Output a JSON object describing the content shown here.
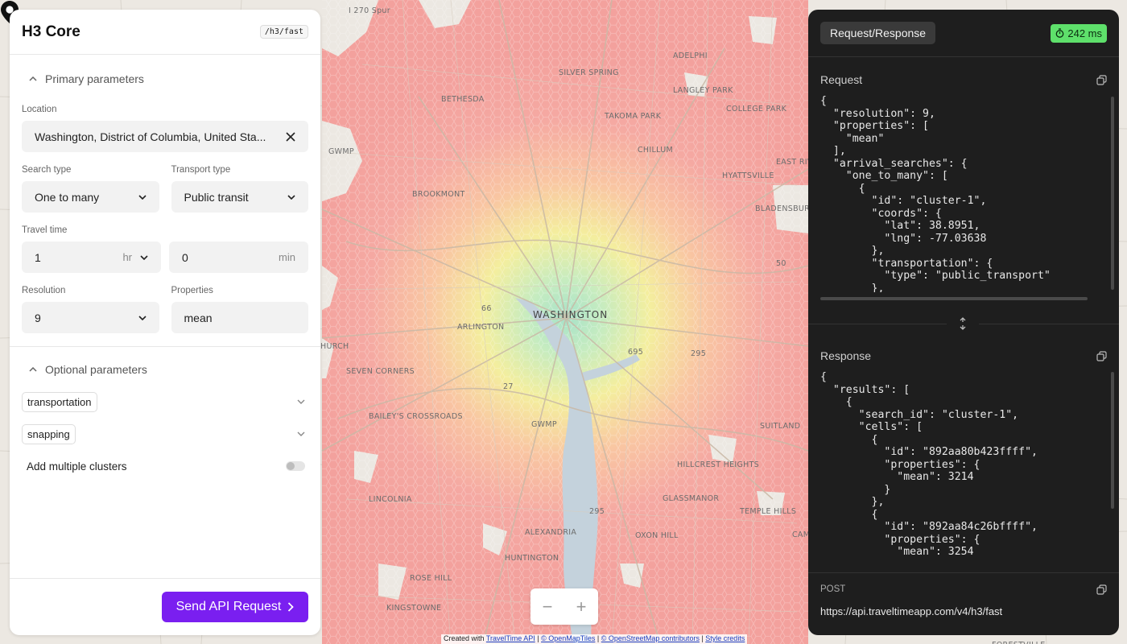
{
  "app": {
    "title": "H3 Core",
    "endpoint_badge": "/h3/fast"
  },
  "primary": {
    "section_label": "Primary parameters",
    "location": {
      "label": "Location",
      "value": "Washington, District of Columbia, United Sta..."
    },
    "search_type": {
      "label": "Search type",
      "value": "One to many"
    },
    "transport_type": {
      "label": "Transport type",
      "value": "Public transit"
    },
    "travel_time": {
      "label": "Travel time",
      "hours": "1",
      "hours_unit": "hr",
      "minutes": "0",
      "minutes_unit": "min"
    },
    "resolution": {
      "label": "Resolution",
      "value": "9"
    },
    "properties": {
      "label": "Properties",
      "value": "mean"
    }
  },
  "optional": {
    "section_label": "Optional parameters",
    "items": [
      "transportation",
      "snapping"
    ],
    "clusters_label": "Add multiple clusters",
    "clusters_enabled": false
  },
  "send_button": "Send API Request",
  "map": {
    "labels": [
      "I 270 Spur",
      "SILVER SPRING",
      "ADELPHI",
      "LANGLEY PARK",
      "BETHESDA",
      "TAKOMA PARK",
      "COLLEGE PARK",
      "CHILLUM",
      "GWMP",
      "EAST RIV",
      "HYATTSVILLE",
      "BROOKMONT",
      "BLADENSBURG",
      "WASHINGTON",
      "ARLINGTON",
      "HURCH",
      "SEVEN CORNERS",
      "BAILEY'S CROSSROADS",
      "SUITLAND",
      "GWMP",
      "HILLCREST HEIGHTS",
      "LINCOLNIA",
      "GLASSMANOR",
      "TEMPLE HILLS",
      "ALEXANDRIA",
      "OXON HILL",
      "CAMP",
      "HUNTINGTON",
      "ROSE HILL",
      "KINGSTOWNE",
      "FORESTVILLE",
      "66",
      "695",
      "295",
      "27",
      "50",
      "295"
    ],
    "zoom_out": "−",
    "zoom_in": "+",
    "attribution": {
      "prefix": "Created with",
      "link1": "TravelTime API",
      "link2": "© OpenMapTiles",
      "link3": "© OpenStreetMap contributors",
      "link4": "Style credits"
    }
  },
  "api_panel": {
    "tab": "Request/Response",
    "timing": "242 ms",
    "request_label": "Request",
    "response_label": "Response",
    "method": "POST",
    "url": "https://api.traveltimeapp.com/v4/h3/fast",
    "request_lines": [
      "{",
      "  \"resolution\": 9,",
      "  \"properties\": [",
      "    \"mean\"",
      "  ],",
      "  \"arrival_searches\": {",
      "    \"one_to_many\": [",
      "      {",
      "        \"id\": \"cluster-1\",",
      "        \"coords\": {",
      "          \"lat\": 38.8951,",
      "          \"lng\": -77.03638",
      "        },",
      "        \"transportation\": {",
      "          \"type\": \"public_transport\"",
      "        },"
    ],
    "response_lines": [
      "{",
      "  \"results\": [",
      "    {",
      "      \"search_id\": \"cluster-1\",",
      "      \"cells\": [",
      "        {",
      "          \"id\": \"892aa80b423ffff\",",
      "          \"properties\": {",
      "            \"mean\": 3214",
      "          }",
      "        },",
      "        {",
      "          \"id\": \"892aa84c26bffff\",",
      "          \"properties\": {",
      "            \"mean\": 3254"
    ]
  }
}
